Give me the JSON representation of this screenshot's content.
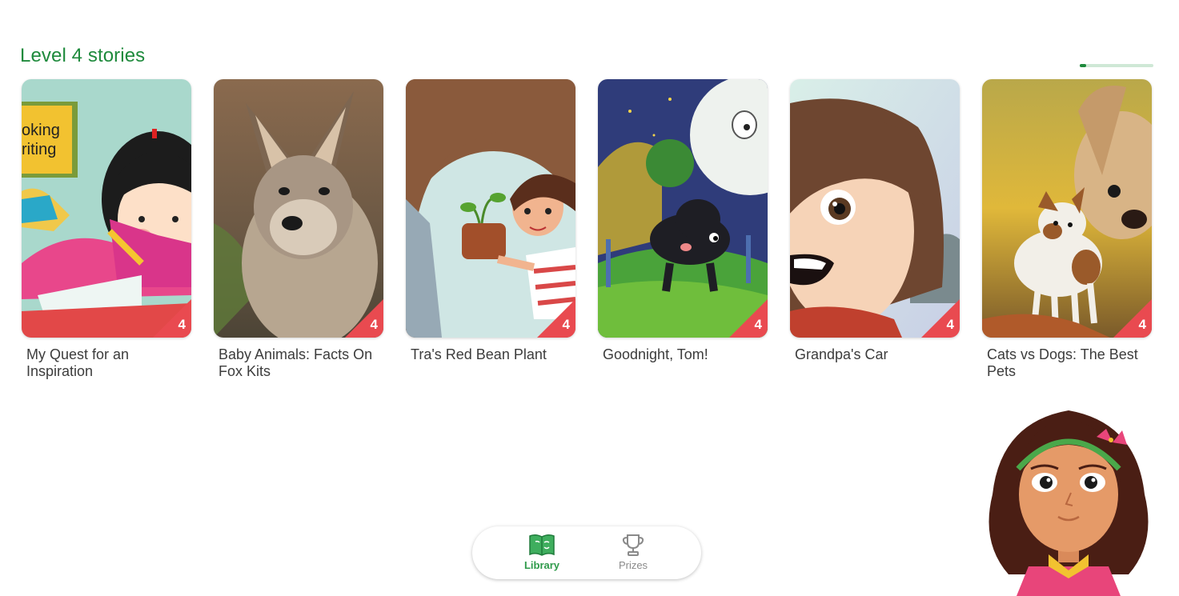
{
  "section": {
    "title": "Level 4 stories",
    "scroll_progress": 0.09
  },
  "books": [
    {
      "title": "My Quest for an Inspiration",
      "level": "4"
    },
    {
      "title": "Baby Animals: Facts On Fox Kits",
      "level": "4"
    },
    {
      "title": "Tra's Red Bean Plant",
      "level": "4"
    },
    {
      "title": "Goodnight, Tom!",
      "level": "4"
    },
    {
      "title": "Grandpa's Car",
      "level": "4"
    },
    {
      "title": "Cats vs Dogs: The Best Pets",
      "level": "4"
    }
  ],
  "cover_texts": {
    "book1_sign": "oking\nriting"
  },
  "nav": {
    "library_label": "Library",
    "prizes_label": "Prizes",
    "active": "library"
  },
  "colors": {
    "accent": "#1e8a3c",
    "badge": "#e94a50",
    "nav_active": "#2e9a4a",
    "nav_inactive": "#8a8a8a"
  }
}
